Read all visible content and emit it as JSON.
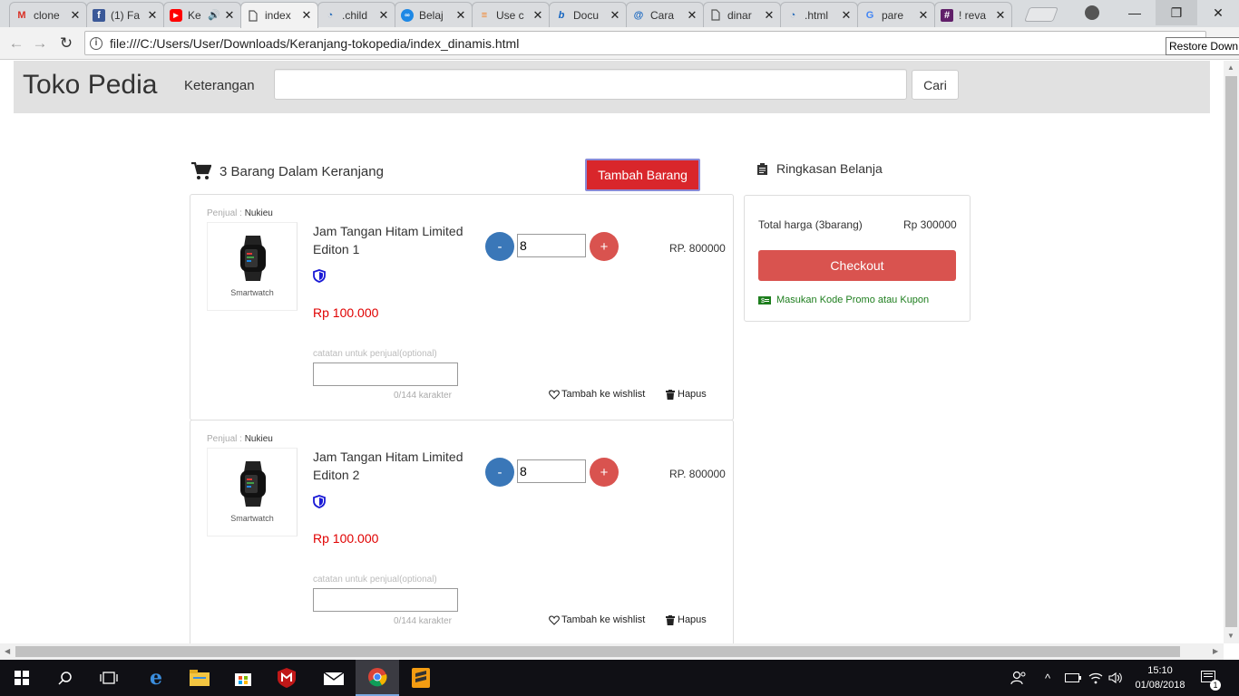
{
  "browser": {
    "tabs": [
      {
        "title": "clone",
        "icon": "gmail-icon",
        "color": "#d93025"
      },
      {
        "title": "(1) Fa",
        "icon": "facebook-icon",
        "color": "#3b5998"
      },
      {
        "title": "Ke",
        "icon": "youtube-icon",
        "color": "#ff0000"
      },
      {
        "title": "index",
        "icon": "page-icon",
        "color": "#555555",
        "active": true
      },
      {
        "title": ".child",
        "icon": "w3-icon",
        "color": "#2c6fbb"
      },
      {
        "title": "Belaj",
        "icon": "belajar-icon",
        "color": "#1e88e5"
      },
      {
        "title": "Use c",
        "icon": "stackoverflow-icon",
        "color": "#f48024"
      },
      {
        "title": "Docu",
        "icon": "bootstrap-icon",
        "color": "#1565c0"
      },
      {
        "title": "Cara",
        "icon": "cara-icon",
        "color": "#1565c0"
      },
      {
        "title": "dinar",
        "icon": "page-icon",
        "color": "#555555"
      },
      {
        "title": ".html",
        "icon": "w3-icon",
        "color": "#2c6fbb"
      },
      {
        "title": "pare",
        "icon": "google-icon",
        "color": "#4285f4"
      },
      {
        "title": "! reva",
        "icon": "slack-icon",
        "color": "#611f69"
      }
    ],
    "url": "file:///C:/Users/User/Downloads/Keranjang-tokopedia/index_dinamis.html",
    "tooltip": "Restore Down"
  },
  "header": {
    "brand": "Toko Pedia",
    "search_label": "Keterangan",
    "search_value": "",
    "search_button": "Cari"
  },
  "cart": {
    "title": "3 Barang Dalam Keranjang",
    "add_button": "Tambah Barang",
    "items": [
      {
        "seller_label": "Penjual :",
        "seller": "Nukieu",
        "image_caption": "Smartwatch",
        "name": "Jam Tangan Hitam Limited Editon 1",
        "price": "Rp 100.000",
        "qty": "8",
        "minus": "-",
        "plus": "+",
        "subtotal": "RP. 800000",
        "note_label": "catatan untuk penjual(optional)",
        "note_count": "0/144 karakter",
        "wishlist": "Tambah ke wishlist",
        "delete": "Hapus"
      },
      {
        "seller_label": "Penjual :",
        "seller": "Nukieu",
        "image_caption": "Smartwatch",
        "name": "Jam Tangan Hitam Limited Editon 2",
        "price": "Rp 100.000",
        "qty": "8",
        "minus": "-",
        "plus": "+",
        "subtotal": "RP. 800000",
        "note_label": "catatan untuk penjual(optional)",
        "note_count": "0/144 karakter",
        "wishlist": "Tambah ke wishlist",
        "delete": "Hapus"
      }
    ]
  },
  "summary": {
    "title": "Ringkasan Belanja",
    "total_label": "Total harga (3barang)",
    "total_value": "Rp 300000",
    "checkout": "Checkout",
    "promo": "Masukan Kode Promo atau Kupon"
  },
  "taskbar": {
    "time": "15:10",
    "date": "01/08/2018",
    "notifications": "1"
  },
  "colors": {
    "danger": "#d9534f",
    "primary": "#3a77b8",
    "price": "#e00000",
    "promo": "#1e7e1e"
  }
}
